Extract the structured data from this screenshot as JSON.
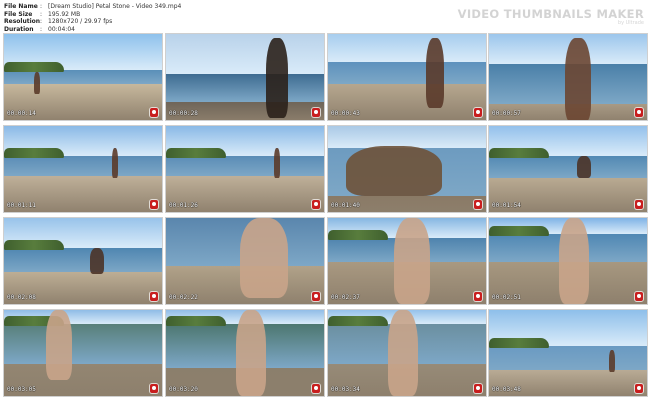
{
  "meta": {
    "rows": [
      {
        "label": "File Name",
        "value": "[Dream Studio] Petal Stone - Video 349.mp4"
      },
      {
        "label": "File Size",
        "value": "195.92 MB"
      },
      {
        "label": "Resolution",
        "value": "1280x720 / 29.97 fps"
      },
      {
        "label": "Duration",
        "value": "00:04:04"
      }
    ],
    "separator": ":"
  },
  "watermark": {
    "title": "VIDEO THUMBNAILS MAKER",
    "sub": "by Ultrade"
  },
  "thumbnails": [
    {
      "timestamp": "00:00:14",
      "scene": "beach-far"
    },
    {
      "timestamp": "00:00:28",
      "scene": "silhouette"
    },
    {
      "timestamp": "00:00:43",
      "scene": "walk-sand"
    },
    {
      "timestamp": "00:00:57",
      "scene": "portrait"
    },
    {
      "timestamp": "00:01:11",
      "scene": "sand-spit"
    },
    {
      "timestamp": "00:01:26",
      "scene": "sand-spit"
    },
    {
      "timestamp": "00:01:40",
      "scene": "boat"
    },
    {
      "timestamp": "00:01:54",
      "scene": "crouch"
    },
    {
      "timestamp": "00:02:08",
      "scene": "crouch-sand"
    },
    {
      "timestamp": "00:02:22",
      "scene": "legs-water"
    },
    {
      "timestamp": "00:02:37",
      "scene": "legs-shore"
    },
    {
      "timestamp": "00:02:51",
      "scene": "legs-walk"
    },
    {
      "timestamp": "00:03:05",
      "scene": "trees-legs"
    },
    {
      "timestamp": "00:03:20",
      "scene": "trees-legs2"
    },
    {
      "timestamp": "00:03:34",
      "scene": "trees-legs3"
    },
    {
      "timestamp": "00:03:48",
      "scene": "beach-far2"
    }
  ],
  "colors": {
    "badge": "#c81e1e",
    "sky": "#7fb2e6",
    "water": "#4d7fa6",
    "sand": "#b8aa95"
  }
}
